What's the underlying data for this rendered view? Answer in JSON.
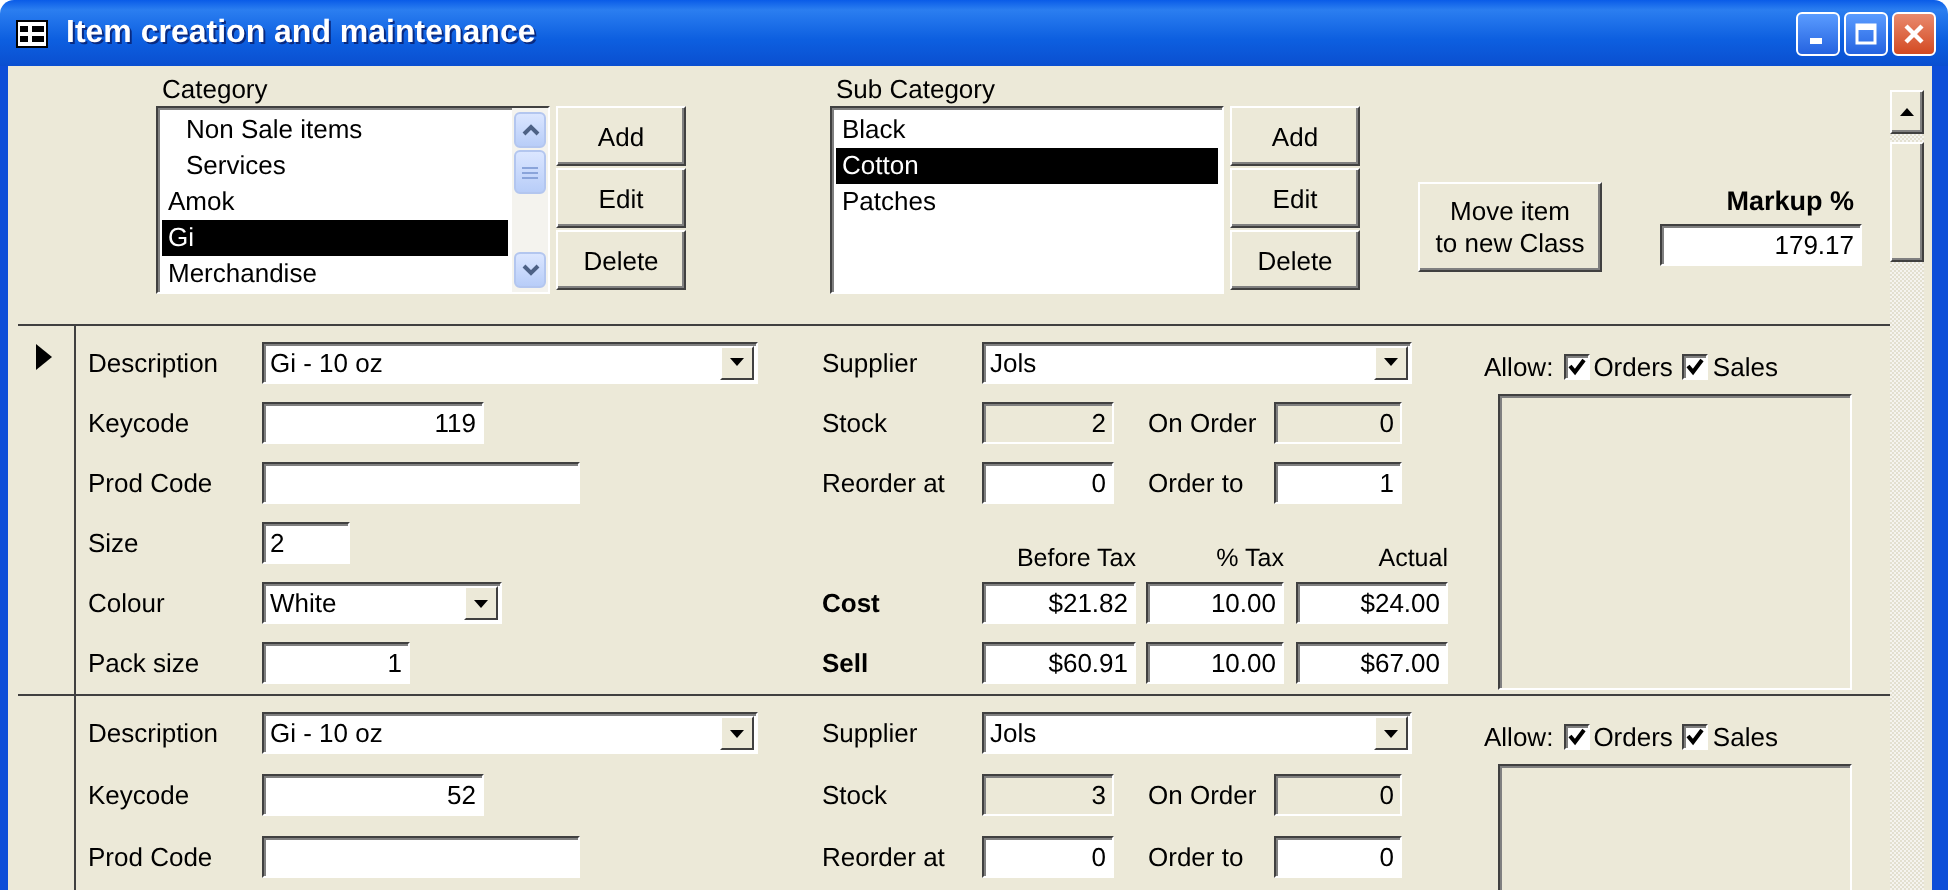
{
  "window": {
    "title": "Item creation and maintenance"
  },
  "category": {
    "label": "Category",
    "items": [
      {
        "text": "Non Sale items",
        "indented": true,
        "selected": false
      },
      {
        "text": "Services",
        "indented": true,
        "selected": false
      },
      {
        "text": "Amok",
        "indented": false,
        "selected": false
      },
      {
        "text": "Gi",
        "indented": false,
        "selected": true
      },
      {
        "text": "Merchandise",
        "indented": false,
        "selected": false
      }
    ],
    "buttons": [
      "Add",
      "Edit",
      "Delete"
    ]
  },
  "subcategory": {
    "label": "Sub Category",
    "items": [
      {
        "text": "Black",
        "indented": false,
        "selected": false
      },
      {
        "text": "Cotton",
        "indented": false,
        "selected": true
      },
      {
        "text": "Patches",
        "indented": false,
        "selected": false
      }
    ],
    "buttons": [
      "Add",
      "Edit",
      "Delete"
    ]
  },
  "move_button": {
    "lines": [
      "Move item",
      "to new Class"
    ]
  },
  "markup": {
    "label": "Markup %",
    "value": "179.17"
  },
  "records": [
    {
      "current": true,
      "left": [
        {
          "kind": "combo",
          "label": "Description",
          "value": "Gi - 10 oz"
        },
        {
          "kind": "number",
          "label": "Keycode",
          "value": "119"
        },
        {
          "kind": "text",
          "label": "Prod Code"
        },
        {
          "kind": "text",
          "label": "Size",
          "value": "2"
        },
        {
          "kind": "combo",
          "label": "Colour",
          "value": "White"
        },
        {
          "kind": "number",
          "label": "Pack size",
          "value": "1"
        }
      ],
      "supplier": {
        "label": "Supplier",
        "value": "Jols"
      },
      "stock_rows": [
        {
          "cells": [
            {
              "label": "Stock",
              "value": "2",
              "read_only": true
            },
            {
              "label": "On Order",
              "value": "0",
              "read_only": true
            }
          ]
        },
        {
          "cells": [
            {
              "label": "Reorder at",
              "value": "0",
              "read_only": false
            },
            {
              "label": "Order to",
              "value": "1",
              "read_only": false
            }
          ]
        }
      ],
      "price_headers": [
        "Before Tax",
        "% Tax",
        "Actual"
      ],
      "prices": [
        {
          "label": "Cost",
          "values": [
            "$21.82",
            "10.00",
            "$24.00"
          ]
        },
        {
          "label": "Sell",
          "values": [
            "$60.91",
            "10.00",
            "$67.00"
          ]
        }
      ],
      "allow": {
        "label": "Allow:",
        "options": [
          {
            "label": "Orders",
            "checked": true
          },
          {
            "label": "Sales",
            "checked": true
          }
        ]
      }
    },
    {
      "current": false,
      "left": [
        {
          "kind": "combo",
          "label": "Description",
          "value": "Gi - 10 oz"
        },
        {
          "kind": "number",
          "label": "Keycode",
          "value": "52"
        },
        {
          "kind": "text",
          "label": "Prod Code"
        }
      ],
      "supplier": {
        "label": "Supplier",
        "value": "Jols"
      },
      "stock_rows": [
        {
          "cells": [
            {
              "label": "Stock",
              "value": "3",
              "read_only": true
            },
            {
              "label": "On Order",
              "value": "0",
              "read_only": true
            }
          ]
        },
        {
          "cells": [
            {
              "label": "Reorder at",
              "value": "0",
              "read_only": false
            },
            {
              "label": "Order to",
              "value": "0",
              "read_only": false
            }
          ]
        }
      ],
      "allow": {
        "label": "Allow:",
        "options": [
          {
            "label": "Orders",
            "checked": true
          },
          {
            "label": "Sales",
            "checked": true
          }
        ]
      }
    }
  ]
}
